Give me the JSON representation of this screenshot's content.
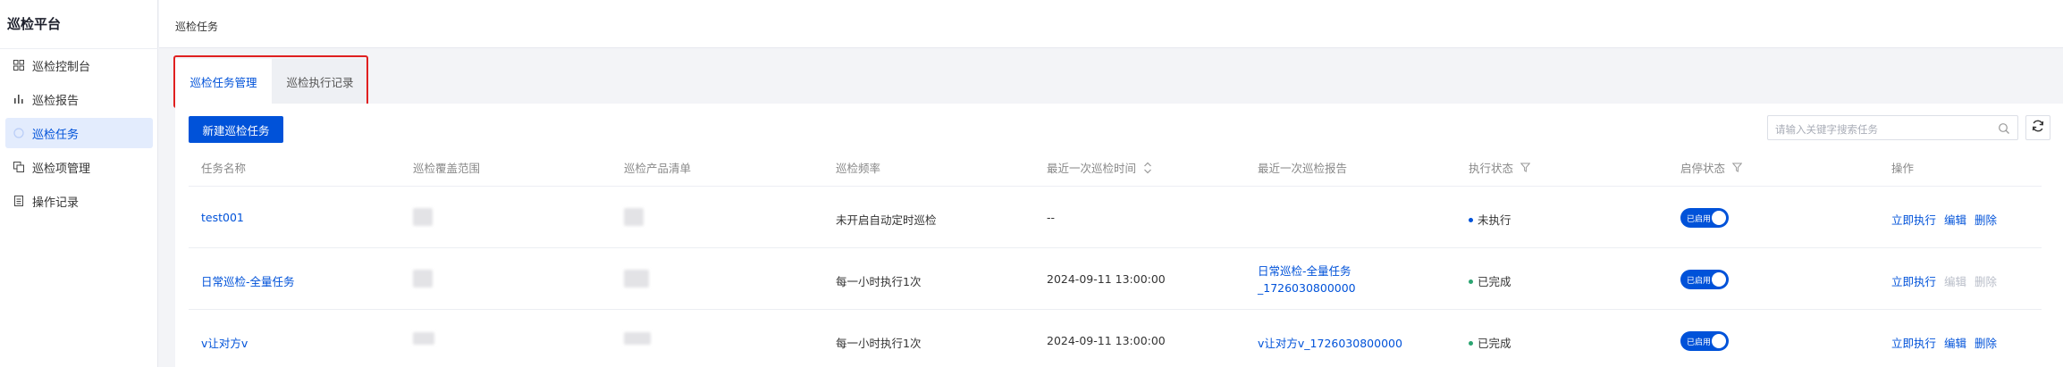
{
  "sidebar": {
    "brand": "巡检平台",
    "items": [
      {
        "label": "巡检控制台",
        "icon": "dashboard-icon",
        "active": false
      },
      {
        "label": "巡检报告",
        "icon": "bar-chart-icon",
        "active": false
      },
      {
        "label": "巡检任务",
        "icon": "task-icon",
        "active": true
      },
      {
        "label": "巡检项管理",
        "icon": "copy-icon",
        "active": false
      },
      {
        "label": "操作记录",
        "icon": "record-icon",
        "active": false
      }
    ]
  },
  "header": {
    "breadcrumb": "巡检任务"
  },
  "tabs": [
    {
      "label": "巡检任务管理",
      "active": true
    },
    {
      "label": "巡检执行记录",
      "active": false
    }
  ],
  "toolbar": {
    "new_button": "新建巡检任务",
    "search_placeholder": "请输入关键字搜索任务"
  },
  "table": {
    "columns": [
      "任务名称",
      "巡检覆盖范围",
      "巡检产品清单",
      "巡检频率",
      "最近一次巡检时间",
      "最近一次巡检报告",
      "执行状态",
      "启停状态",
      "操作"
    ],
    "rows": [
      {
        "name": "test001",
        "frequency": "未开启自动定时巡检",
        "last_time": "--",
        "report_line1": "",
        "report_line2": "",
        "status": "未执行",
        "status_color": "#0052d9",
        "toggle": "已启用",
        "actions": [
          "立即执行",
          "编辑",
          "删除"
        ],
        "actions_disabled": [
          false,
          false,
          false
        ]
      },
      {
        "name": "日常巡检-全量任务",
        "frequency": "每一小时执行1次",
        "last_time": "2024-09-11 13:00:00",
        "report_line1": "日常巡检-全量任务",
        "report_line2": "_1726030800000",
        "status": "已完成",
        "status_color": "#2ba471",
        "toggle": "已启用",
        "actions": [
          "立即执行",
          "编辑",
          "删除"
        ],
        "actions_disabled": [
          false,
          true,
          true
        ]
      },
      {
        "name": "v让对方v",
        "frequency": "每一小时执行1次",
        "last_time": "2024-09-11 13:00:00",
        "report_line1": "v让对方v_1726030800000",
        "report_line2": "",
        "status": "已完成",
        "status_color": "#2ba471",
        "toggle": "已启用",
        "actions": [
          "立即执行",
          "编辑",
          "删除"
        ],
        "actions_disabled": [
          false,
          false,
          false
        ]
      }
    ]
  },
  "colors": {
    "accent": "#0052d9",
    "highlight": "#e02020",
    "success": "#2ba471"
  }
}
